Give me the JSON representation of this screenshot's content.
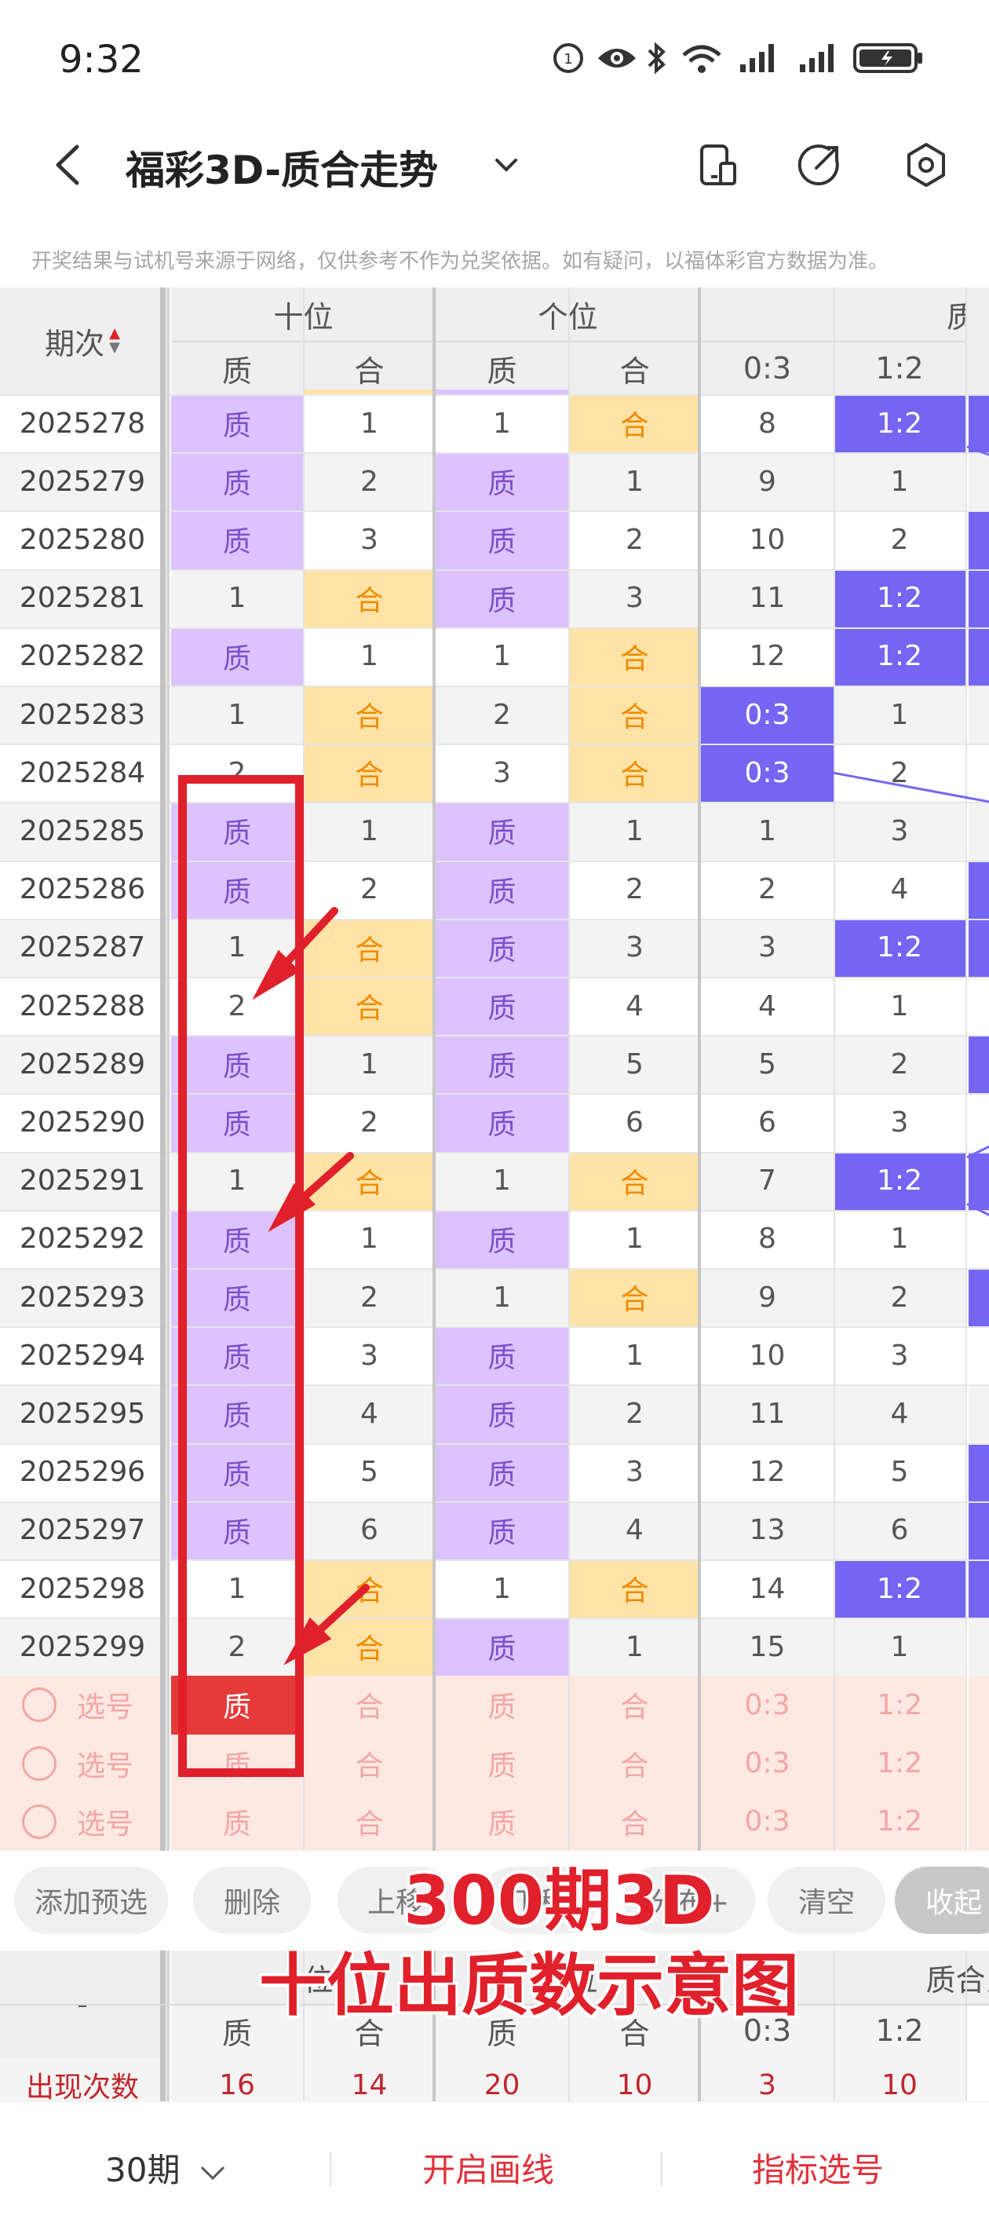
{
  "status_bar": {
    "time": "9:32",
    "icons": [
      "alarm-icon",
      "eye-icon",
      "bluetooth-icon",
      "wifi-icon",
      "signal-icon",
      "signal-icon",
      "battery-icon"
    ]
  },
  "header": {
    "title": "福彩3D-质合走势",
    "disclaimer": "开奖结果与试机号来源于网络，仅供参考不作为兑奖依据。如有疑问，以福体彩官方数据为准。"
  },
  "table": {
    "period_header": "期次",
    "groups": [
      "十位",
      "个位",
      "质合比"
    ],
    "sub_headers": [
      "质",
      "合",
      "质",
      "合",
      "0:3",
      "1:2"
    ],
    "rows": [
      {
        "period": "2025278",
        "c": [
          {
            "t": "质",
            "s": "p"
          },
          {
            "t": "1",
            "s": ""
          },
          {
            "t": "1",
            "s": ""
          },
          {
            "t": "合",
            "s": "o"
          },
          {
            "t": "8",
            "s": ""
          },
          {
            "t": "1:2",
            "s": "b"
          }
        ]
      },
      {
        "period": "2025279",
        "c": [
          {
            "t": "质",
            "s": "p"
          },
          {
            "t": "2",
            "s": ""
          },
          {
            "t": "质",
            "s": "p"
          },
          {
            "t": "1",
            "s": ""
          },
          {
            "t": "9",
            "s": ""
          },
          {
            "t": "1",
            "s": ""
          }
        ]
      },
      {
        "period": "2025280",
        "c": [
          {
            "t": "质",
            "s": "p"
          },
          {
            "t": "3",
            "s": ""
          },
          {
            "t": "质",
            "s": "p"
          },
          {
            "t": "2",
            "s": ""
          },
          {
            "t": "10",
            "s": ""
          },
          {
            "t": "2",
            "s": ""
          }
        ]
      },
      {
        "period": "2025281",
        "c": [
          {
            "t": "1",
            "s": ""
          },
          {
            "t": "合",
            "s": "o"
          },
          {
            "t": "质",
            "s": "p"
          },
          {
            "t": "3",
            "s": ""
          },
          {
            "t": "11",
            "s": ""
          },
          {
            "t": "1:2",
            "s": "b"
          }
        ]
      },
      {
        "period": "2025282",
        "c": [
          {
            "t": "质",
            "s": "p"
          },
          {
            "t": "1",
            "s": ""
          },
          {
            "t": "1",
            "s": ""
          },
          {
            "t": "合",
            "s": "o"
          },
          {
            "t": "12",
            "s": ""
          },
          {
            "t": "1:2",
            "s": "b"
          }
        ]
      },
      {
        "period": "2025283",
        "c": [
          {
            "t": "1",
            "s": ""
          },
          {
            "t": "合",
            "s": "o"
          },
          {
            "t": "2",
            "s": ""
          },
          {
            "t": "合",
            "s": "o"
          },
          {
            "t": "0:3",
            "s": "b"
          },
          {
            "t": "1",
            "s": ""
          }
        ]
      },
      {
        "period": "2025284",
        "c": [
          {
            "t": "2",
            "s": ""
          },
          {
            "t": "合",
            "s": "o"
          },
          {
            "t": "3",
            "s": ""
          },
          {
            "t": "合",
            "s": "o"
          },
          {
            "t": "0:3",
            "s": "b"
          },
          {
            "t": "2",
            "s": ""
          }
        ]
      },
      {
        "period": "2025285",
        "c": [
          {
            "t": "质",
            "s": "p"
          },
          {
            "t": "1",
            "s": ""
          },
          {
            "t": "质",
            "s": "p"
          },
          {
            "t": "1",
            "s": ""
          },
          {
            "t": "1",
            "s": ""
          },
          {
            "t": "3",
            "s": ""
          }
        ]
      },
      {
        "period": "2025286",
        "c": [
          {
            "t": "质",
            "s": "p"
          },
          {
            "t": "2",
            "s": ""
          },
          {
            "t": "质",
            "s": "p"
          },
          {
            "t": "2",
            "s": ""
          },
          {
            "t": "2",
            "s": ""
          },
          {
            "t": "4",
            "s": ""
          }
        ]
      },
      {
        "period": "2025287",
        "c": [
          {
            "t": "1",
            "s": ""
          },
          {
            "t": "合",
            "s": "o"
          },
          {
            "t": "质",
            "s": "p"
          },
          {
            "t": "3",
            "s": ""
          },
          {
            "t": "3",
            "s": ""
          },
          {
            "t": "1:2",
            "s": "b"
          }
        ]
      },
      {
        "period": "2025288",
        "c": [
          {
            "t": "2",
            "s": ""
          },
          {
            "t": "合",
            "s": "o"
          },
          {
            "t": "质",
            "s": "p"
          },
          {
            "t": "4",
            "s": ""
          },
          {
            "t": "4",
            "s": ""
          },
          {
            "t": "1",
            "s": ""
          }
        ]
      },
      {
        "period": "2025289",
        "c": [
          {
            "t": "质",
            "s": "p"
          },
          {
            "t": "1",
            "s": ""
          },
          {
            "t": "质",
            "s": "p"
          },
          {
            "t": "5",
            "s": ""
          },
          {
            "t": "5",
            "s": ""
          },
          {
            "t": "2",
            "s": ""
          }
        ]
      },
      {
        "period": "2025290",
        "c": [
          {
            "t": "质",
            "s": "p"
          },
          {
            "t": "2",
            "s": ""
          },
          {
            "t": "质",
            "s": "p"
          },
          {
            "t": "6",
            "s": ""
          },
          {
            "t": "6",
            "s": ""
          },
          {
            "t": "3",
            "s": ""
          }
        ]
      },
      {
        "period": "2025291",
        "c": [
          {
            "t": "1",
            "s": ""
          },
          {
            "t": "合",
            "s": "o"
          },
          {
            "t": "1",
            "s": ""
          },
          {
            "t": "合",
            "s": "o"
          },
          {
            "t": "7",
            "s": ""
          },
          {
            "t": "1:2",
            "s": "b"
          }
        ]
      },
      {
        "period": "2025292",
        "c": [
          {
            "t": "质",
            "s": "p"
          },
          {
            "t": "1",
            "s": ""
          },
          {
            "t": "质",
            "s": "p"
          },
          {
            "t": "1",
            "s": ""
          },
          {
            "t": "8",
            "s": ""
          },
          {
            "t": "1",
            "s": ""
          }
        ]
      },
      {
        "period": "2025293",
        "c": [
          {
            "t": "质",
            "s": "p"
          },
          {
            "t": "2",
            "s": ""
          },
          {
            "t": "1",
            "s": ""
          },
          {
            "t": "合",
            "s": "o"
          },
          {
            "t": "9",
            "s": ""
          },
          {
            "t": "2",
            "s": ""
          }
        ]
      },
      {
        "period": "2025294",
        "c": [
          {
            "t": "质",
            "s": "p"
          },
          {
            "t": "3",
            "s": ""
          },
          {
            "t": "质",
            "s": "p"
          },
          {
            "t": "1",
            "s": ""
          },
          {
            "t": "10",
            "s": ""
          },
          {
            "t": "3",
            "s": ""
          }
        ]
      },
      {
        "period": "2025295",
        "c": [
          {
            "t": "质",
            "s": "p"
          },
          {
            "t": "4",
            "s": ""
          },
          {
            "t": "质",
            "s": "p"
          },
          {
            "t": "2",
            "s": ""
          },
          {
            "t": "11",
            "s": ""
          },
          {
            "t": "4",
            "s": ""
          }
        ]
      },
      {
        "period": "2025296",
        "c": [
          {
            "t": "质",
            "s": "p"
          },
          {
            "t": "5",
            "s": ""
          },
          {
            "t": "质",
            "s": "p"
          },
          {
            "t": "3",
            "s": ""
          },
          {
            "t": "12",
            "s": ""
          },
          {
            "t": "5",
            "s": ""
          }
        ]
      },
      {
        "period": "2025297",
        "c": [
          {
            "t": "质",
            "s": "p"
          },
          {
            "t": "6",
            "s": ""
          },
          {
            "t": "质",
            "s": "p"
          },
          {
            "t": "4",
            "s": ""
          },
          {
            "t": "13",
            "s": ""
          },
          {
            "t": "6",
            "s": ""
          }
        ]
      },
      {
        "period": "2025298",
        "c": [
          {
            "t": "1",
            "s": ""
          },
          {
            "t": "合",
            "s": "o"
          },
          {
            "t": "1",
            "s": ""
          },
          {
            "t": "合",
            "s": "o"
          },
          {
            "t": "14",
            "s": ""
          },
          {
            "t": "1:2",
            "s": "b"
          }
        ]
      },
      {
        "period": "2025299",
        "c": [
          {
            "t": "2",
            "s": ""
          },
          {
            "t": "合",
            "s": "o"
          },
          {
            "t": "质",
            "s": "p"
          },
          {
            "t": "1",
            "s": ""
          },
          {
            "t": "15",
            "s": ""
          },
          {
            "t": "1",
            "s": ""
          }
        ]
      }
    ],
    "select_rows": [
      {
        "label": "选号",
        "c": [
          "质",
          "合",
          "质",
          "合",
          "0:3",
          "1:2"
        ],
        "selected": 0
      },
      {
        "label": "选号",
        "c": [
          "质",
          "合",
          "质",
          "合",
          "0:3",
          "1:2"
        ],
        "selected": -1
      },
      {
        "label": "选号",
        "c": [
          "质",
          "合",
          "质",
          "合",
          "0:3",
          "1:2"
        ],
        "selected": -1
      }
    ]
  },
  "toolbar": {
    "buttons": [
      "添加预选",
      "删除",
      "上移",
      "下移",
      "分布+",
      "清空",
      "收起"
    ]
  },
  "stats": {
    "dash": "-",
    "groups": [
      "十位",
      "个位",
      "质合比"
    ],
    "sub_headers": [
      "质",
      "合",
      "质",
      "合",
      "0:3",
      "1:2"
    ],
    "row_label": "出现次数",
    "values": [
      "16",
      "14",
      "20",
      "10",
      "3",
      "10"
    ]
  },
  "bottom_bar": {
    "period_select": "30期",
    "draw_line": "开启画线",
    "indicator_select": "指标选号"
  },
  "annotation": {
    "line1": "300期3D",
    "line2": "十位出质数示意图"
  },
  "colors": {
    "prime_bg": "#dcc3ff",
    "composite_bg": "#ffe3a6",
    "ratio_bg": "#7465f2",
    "accent_red": "#e0202a"
  }
}
